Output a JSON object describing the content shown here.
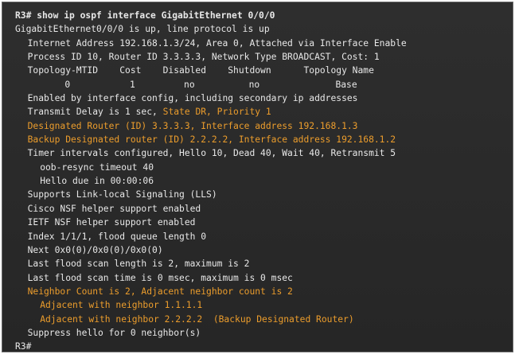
{
  "colors": {
    "background": "#2b2b2b",
    "text": "#e8e8e8",
    "highlight": "#ec9d2c",
    "border": "#6b6b6b"
  },
  "terminal": {
    "lines": [
      {
        "indent": 0,
        "bold": true,
        "parts": [
          {
            "text": "R3# show ip ospf interface GigabitEthernet 0/0/0",
            "hl": false
          }
        ]
      },
      {
        "indent": 0,
        "parts": [
          {
            "text": "GigabitEthernet0/0/0 is up, line protocol is up",
            "hl": false
          }
        ]
      },
      {
        "indent": 2,
        "parts": [
          {
            "text": "Internet Address 192.168.1.3/24, Area 0, Attached via Interface Enable",
            "hl": false
          }
        ]
      },
      {
        "indent": 2,
        "parts": [
          {
            "text": "Process ID 10, Router ID 3.3.3.3, Network Type BROADCAST, Cost: 1",
            "hl": false
          }
        ]
      },
      {
        "indent": 2,
        "parts": [
          {
            "text": "Topology-MTID    Cost    Disabled    Shutdown      Topology Name",
            "hl": false
          }
        ]
      },
      {
        "indent": 8,
        "parts": [
          {
            "text": "0           1         no          no              Base",
            "hl": false
          }
        ]
      },
      {
        "indent": 2,
        "parts": [
          {
            "text": "Enabled by interface config, including secondary ip addresses",
            "hl": false
          }
        ]
      },
      {
        "indent": 2,
        "parts": [
          {
            "text": "Transmit Delay is 1 sec, ",
            "hl": false
          },
          {
            "text": "State DR, Priority 1",
            "hl": true
          }
        ]
      },
      {
        "indent": 2,
        "parts": [
          {
            "text": "Designated Router (ID) 3.3.3.3, Interface address 192.168.1.3",
            "hl": true
          }
        ]
      },
      {
        "indent": 2,
        "parts": [
          {
            "text": "Backup Designated router (ID) 2.2.2.2, Interface address 192.168.1.2",
            "hl": true
          }
        ]
      },
      {
        "indent": 2,
        "parts": [
          {
            "text": "Timer intervals configured, Hello 10, Dead 40, Wait 40, Retransmit 5",
            "hl": false
          }
        ]
      },
      {
        "indent": 4,
        "parts": [
          {
            "text": "oob-resync timeout 40",
            "hl": false
          }
        ]
      },
      {
        "indent": 4,
        "parts": [
          {
            "text": "Hello due in 00:00:06",
            "hl": false
          }
        ]
      },
      {
        "indent": 2,
        "parts": [
          {
            "text": "Supports Link-local Signaling (LLS)",
            "hl": false
          }
        ]
      },
      {
        "indent": 2,
        "parts": [
          {
            "text": "Cisco NSF helper support enabled",
            "hl": false
          }
        ]
      },
      {
        "indent": 2,
        "parts": [
          {
            "text": "IETF NSF helper support enabled",
            "hl": false
          }
        ]
      },
      {
        "indent": 2,
        "parts": [
          {
            "text": "Index 1/1/1, flood queue length 0",
            "hl": false
          }
        ]
      },
      {
        "indent": 2,
        "parts": [
          {
            "text": "Next 0x0(0)/0x0(0)/0x0(0)",
            "hl": false
          }
        ]
      },
      {
        "indent": 2,
        "parts": [
          {
            "text": "Last flood scan length is 2, maximum is 2",
            "hl": false
          }
        ]
      },
      {
        "indent": 2,
        "parts": [
          {
            "text": "Last flood scan time is 0 msec, maximum is 0 msec",
            "hl": false
          }
        ]
      },
      {
        "indent": 2,
        "parts": [
          {
            "text": "Neighbor Count is 2, Adjacent neighbor count is 2",
            "hl": true
          }
        ]
      },
      {
        "indent": 4,
        "parts": [
          {
            "text": "Adjacent with neighbor 1.1.1.1",
            "hl": true
          }
        ]
      },
      {
        "indent": 4,
        "parts": [
          {
            "text": "Adjacent with neighbor 2.2.2.2  (Backup Designated Router)",
            "hl": true
          }
        ]
      },
      {
        "indent": 2,
        "parts": [
          {
            "text": "Suppress hello for 0 neighbor(s)",
            "hl": false
          }
        ]
      },
      {
        "indent": 0,
        "parts": [
          {
            "text": "R3#",
            "hl": false
          }
        ]
      }
    ]
  }
}
